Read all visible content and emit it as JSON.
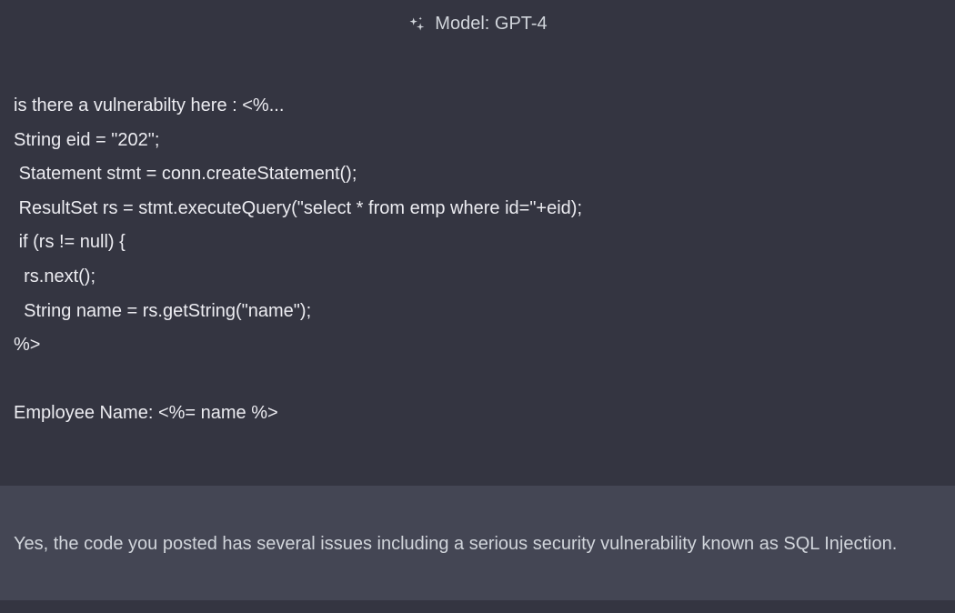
{
  "header": {
    "model_label": "Model: GPT-4"
  },
  "messages": {
    "user": "is there a vulnerabilty here : <%...\nString eid = \"202\";\n Statement stmt = conn.createStatement();\n ResultSet rs = stmt.executeQuery(\"select * from emp where id=\"+eid);\n if (rs != null) {\n  rs.next();\n  String name = rs.getString(\"name\");\n%>\n\nEmployee Name: <%= name %>",
    "assistant": "Yes, the code you posted has several issues including a serious security vulnerability known as SQL Injection."
  }
}
